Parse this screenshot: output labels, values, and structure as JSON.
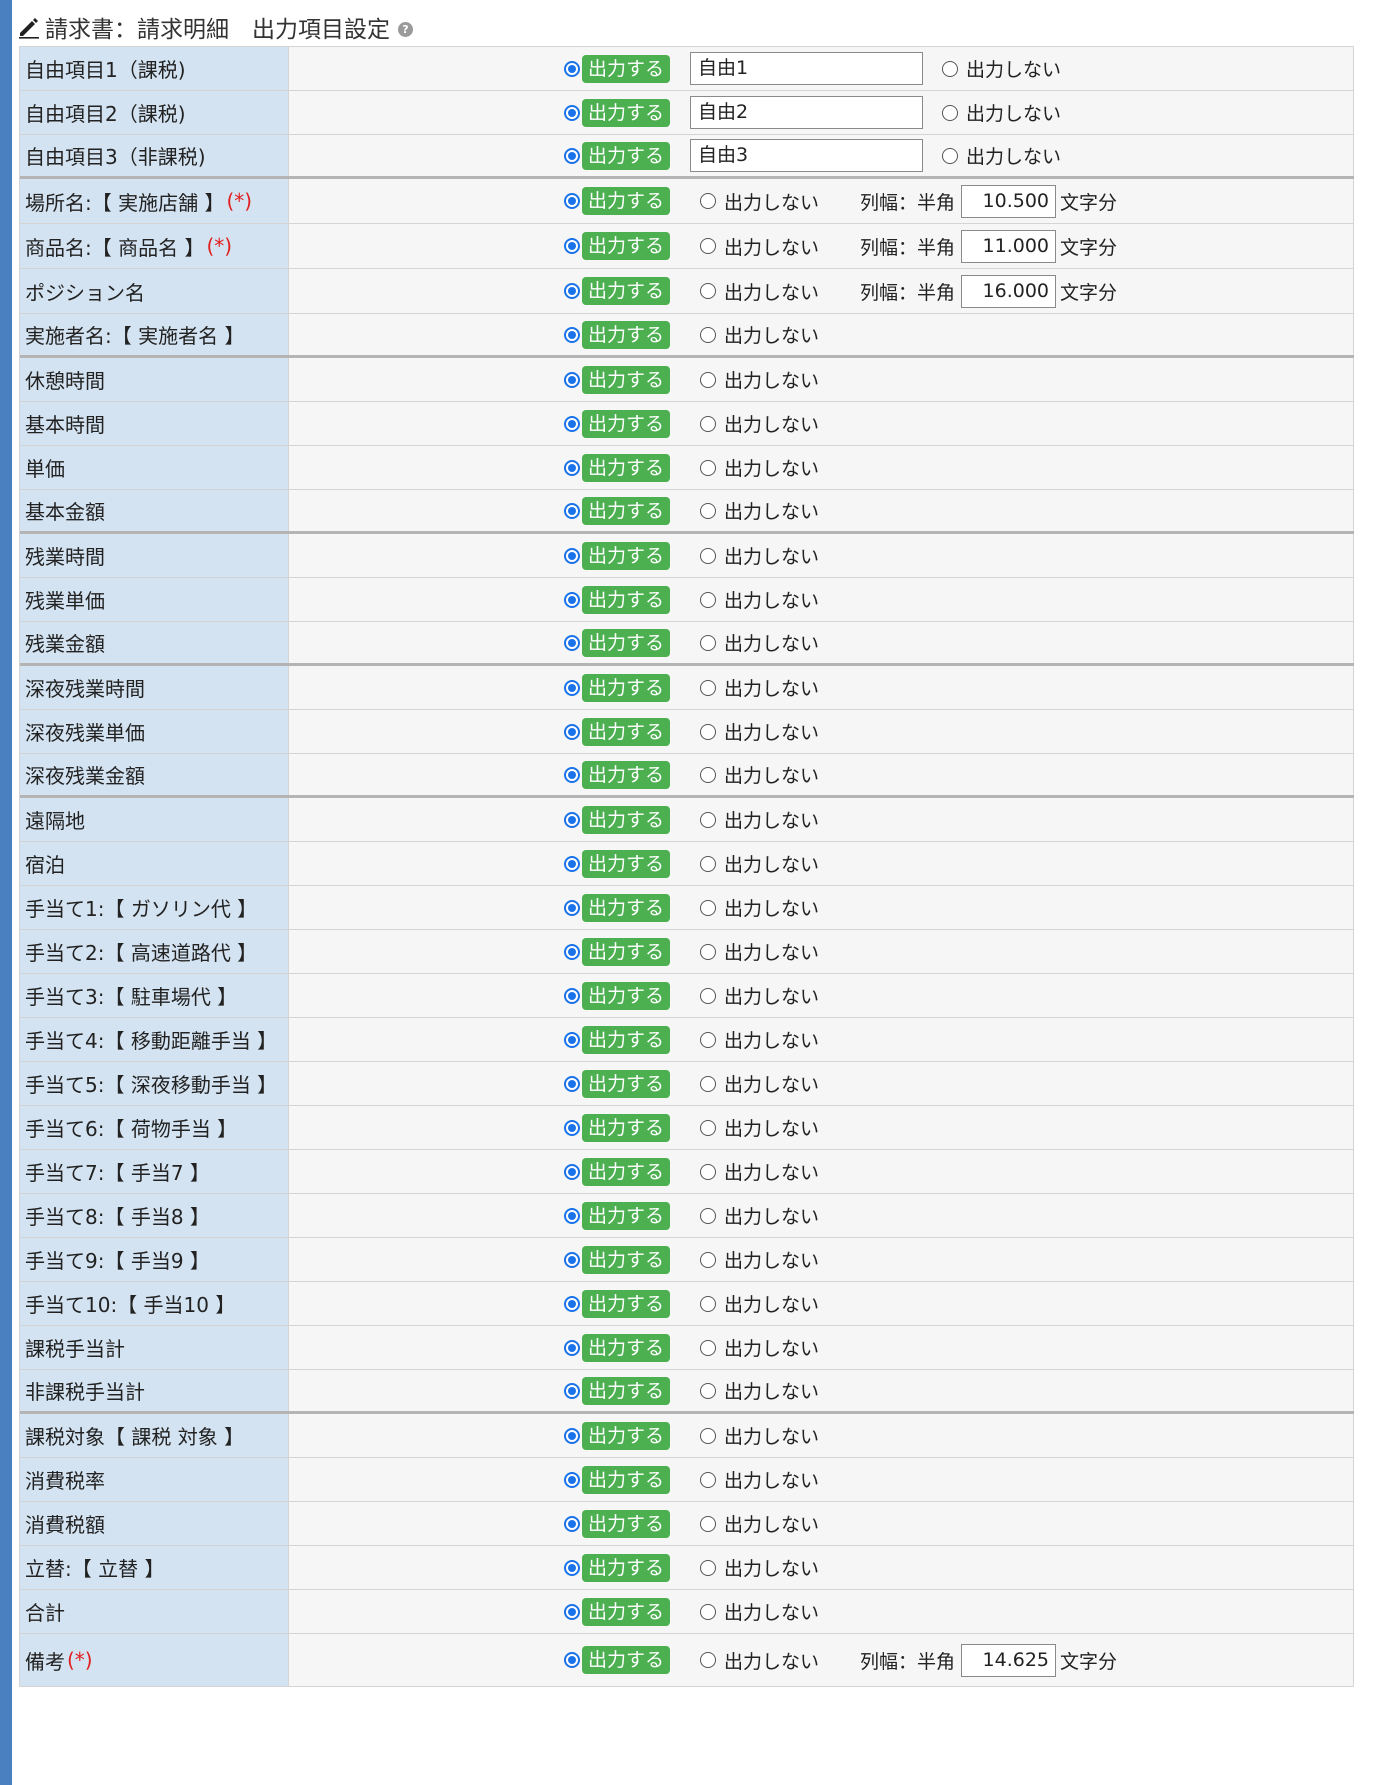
{
  "header": {
    "title": "請求書：請求明細　出力項目設定"
  },
  "labels": {
    "output_on": "出力する",
    "output_off": "出力しない",
    "width_label": "列幅：半角",
    "width_suffix": "文字分",
    "required_mark": "(*)"
  },
  "rows": [
    {
      "label": "自由項目1（課税)",
      "text": "自由1"
    },
    {
      "label": "自由項目2（課税)",
      "text": "自由2"
    },
    {
      "label": "自由項目3（非課税)",
      "text": "自由3"
    },
    {
      "label": "場所名:【 実施店舗 】",
      "width": "10.500"
    },
    {
      "label": "商品名:【 商品名 】",
      "width": "11.000"
    },
    {
      "label": "ポジション名",
      "width": "16.000"
    },
    {
      "label": "実施者名:【 実施者名 】"
    },
    {
      "label": "休憩時間"
    },
    {
      "label": "基本時間"
    },
    {
      "label": "単価"
    },
    {
      "label": "基本金額"
    },
    {
      "label": "残業時間"
    },
    {
      "label": "残業単価"
    },
    {
      "label": "残業金額"
    },
    {
      "label": "深夜残業時間"
    },
    {
      "label": "深夜残業単価"
    },
    {
      "label": "深夜残業金額"
    },
    {
      "label": "遠隔地"
    },
    {
      "label": "宿泊"
    },
    {
      "label": "手当て1:【 ガソリン代 】"
    },
    {
      "label": "手当て2:【 高速道路代 】"
    },
    {
      "label": "手当て3:【 駐車場代 】"
    },
    {
      "label": "手当て4:【 移動距離手当 】"
    },
    {
      "label": "手当て5:【 深夜移動手当 】"
    },
    {
      "label": "手当て6:【 荷物手当 】"
    },
    {
      "label": "手当て7:【 手当7 】"
    },
    {
      "label": "手当て8:【 手当8 】"
    },
    {
      "label": "手当て9:【 手当9 】"
    },
    {
      "label": "手当て10:【 手当10 】"
    },
    {
      "label": "課税手当計"
    },
    {
      "label": "非課税手当計"
    },
    {
      "label": "課税対象【 課税 対象 】"
    },
    {
      "label": "消費税率"
    },
    {
      "label": "消費税額"
    },
    {
      "label": "立替:【 立替 】"
    },
    {
      "label": "合計"
    },
    {
      "label": "備考",
      "width": "14.625"
    }
  ]
}
